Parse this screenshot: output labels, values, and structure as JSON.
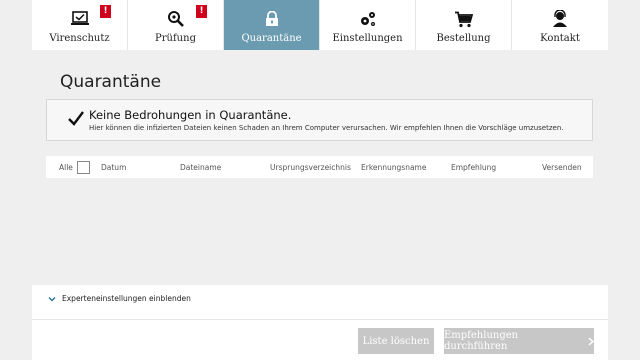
{
  "nav": {
    "items": [
      {
        "label": "Virenschutz",
        "icon": "laptop-icon",
        "alert": "!"
      },
      {
        "label": "Prüfung",
        "icon": "magnifier-icon",
        "alert": "!"
      },
      {
        "label": "Quarantäne",
        "icon": "lock-icon",
        "active": true
      },
      {
        "label": "Einstellungen",
        "icon": "gears-icon"
      },
      {
        "label": "Bestellung",
        "icon": "cart-icon"
      },
      {
        "label": "Kontakt",
        "icon": "support-icon"
      }
    ]
  },
  "page": {
    "title": "Quarantäne"
  },
  "notice": {
    "title": "Keine Bedrohungen in Quarantäne.",
    "text": "Hier können die infizierten Dateien keinen Schaden an Ihrem Computer verursachen. Wir empfehlen Ihnen die Vorschläge umzusetzen."
  },
  "table": {
    "select_all": "Alle",
    "columns": [
      "Datum",
      "Dateiname",
      "Ursprungsverzeichnis",
      "Erkennungsname",
      "Empfehlung",
      "Versenden"
    ]
  },
  "expert": {
    "label": "Experteneinstellungen einblenden"
  },
  "buttons": {
    "clear": "Liste löschen",
    "apply": "Empfehlungen durchführen"
  },
  "colors": {
    "active_tab": "#6a9bb0",
    "alert": "#d0021b",
    "button_disabled": "#c7c7c7",
    "accent": "#2a6f8f"
  }
}
